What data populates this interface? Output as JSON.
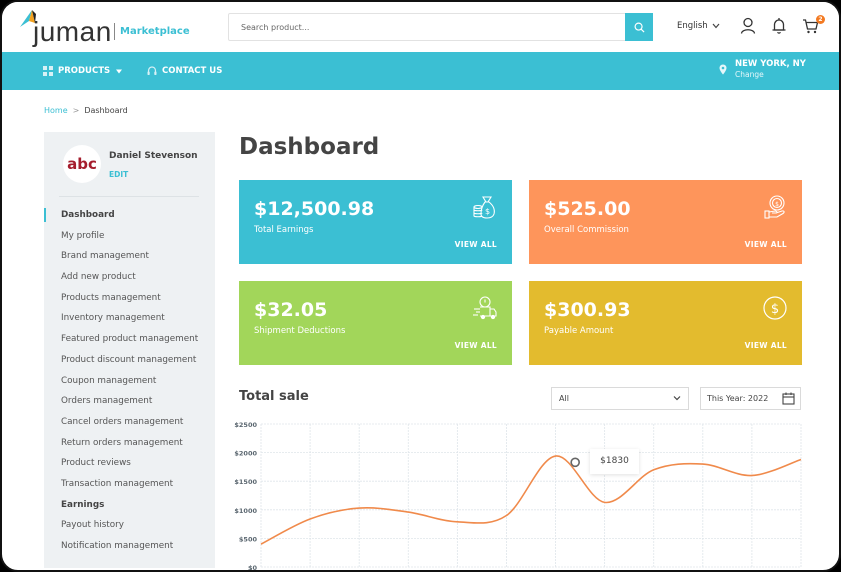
{
  "brand": {
    "name": "juman",
    "sub": "Marketplace"
  },
  "header": {
    "search_placeholder": "Search product...",
    "language": "English",
    "cart_count": "2"
  },
  "nav": {
    "products": "PRODUCTS",
    "contact": "CONTACT US",
    "location_city": "NEW YORK, NY",
    "location_change": "Change"
  },
  "breadcrumb": {
    "home": "Home",
    "sep": ">",
    "current": "Dashboard"
  },
  "user": {
    "name": "Daniel Stevenson",
    "edit": "EDIT",
    "avatar_text": "abc"
  },
  "sidebar": {
    "items": [
      {
        "label": "Dashboard",
        "type": "active"
      },
      {
        "label": "My profile",
        "type": "link"
      },
      {
        "label": "Brand management",
        "type": "link"
      },
      {
        "label": "Add new product",
        "type": "link"
      },
      {
        "label": "Products management",
        "type": "link"
      },
      {
        "label": "Inventory management",
        "type": "link"
      },
      {
        "label": "Featured product management",
        "type": "link"
      },
      {
        "label": "Product discount management",
        "type": "link"
      },
      {
        "label": "Coupon management",
        "type": "link"
      },
      {
        "label": "Orders management",
        "type": "link"
      },
      {
        "label": "Cancel orders management",
        "type": "link"
      },
      {
        "label": "Return orders management",
        "type": "link"
      },
      {
        "label": "Product reviews",
        "type": "link"
      },
      {
        "label": "Transaction management",
        "type": "link"
      },
      {
        "label": "Earnings",
        "type": "section"
      },
      {
        "label": "Payout history",
        "type": "link"
      },
      {
        "label": "Notification management",
        "type": "link"
      }
    ]
  },
  "main": {
    "title": "Dashboard",
    "cards": [
      {
        "value": "$12,500.98",
        "label": "Total Earnings",
        "link": "VIEW ALL",
        "color": "#3bbfd3",
        "icon": "money-bag-icon"
      },
      {
        "value": "$525.00",
        "label": "Overall Commission",
        "link": "VIEW ALL",
        "color": "#fe955b",
        "icon": "commission-hand-icon"
      },
      {
        "value": "$32.05",
        "label": "Shipment Deductions",
        "link": "VIEW ALL",
        "color": "#a2d65a",
        "icon": "delivery-truck-icon"
      },
      {
        "value": "$300.93",
        "label": "Payable Amount",
        "link": "VIEW ALL",
        "color": "#e3bb2e",
        "icon": "dollar-circle-icon"
      }
    ],
    "sale": {
      "title": "Total sale",
      "filter_value": "All",
      "date_value": "This Year: 2022",
      "tooltip": "$1830"
    }
  },
  "chart_data": {
    "type": "line",
    "title": "Total sale",
    "xlabel": "",
    "ylabel": "",
    "x": [
      1,
      2,
      3,
      4,
      5,
      6,
      7,
      8,
      9,
      10,
      11,
      12
    ],
    "series": [
      {
        "name": "Total sale",
        "values": [
          400,
          840,
          1030,
          960,
          790,
          900,
          1940,
          1130,
          1700,
          1800,
          1600,
          1880
        ],
        "color": "#f08a4b"
      }
    ],
    "highlight": {
      "x": 7.4,
      "value": 1830,
      "label": "$1830"
    },
    "yticks": [
      0,
      500,
      1000,
      1500,
      2000,
      2500
    ],
    "ytick_labels": [
      "$0",
      "$500",
      "$1000",
      "$1500",
      "$2000",
      "$2500"
    ],
    "ylim": [
      0,
      2500
    ],
    "grid": true,
    "legend": "none"
  }
}
